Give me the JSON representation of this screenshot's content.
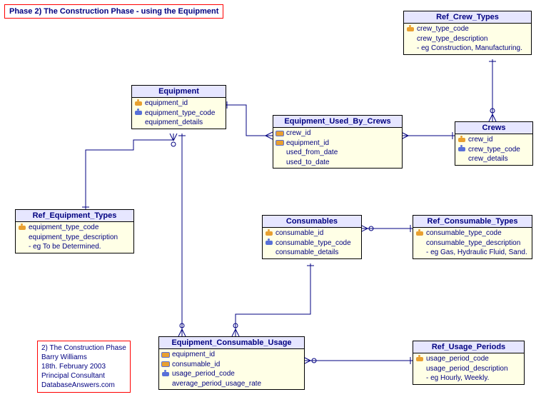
{
  "title": "Phase 2) The Construction Phase - using the Equipment",
  "info": {
    "l1": "2) The Construction Phase",
    "l2": "Barry Williams",
    "l3": "18th. February 2003",
    "l4": "Principal Consultant",
    "l5": "DatabaseAnswers.com"
  },
  "entities": {
    "equipment": {
      "name": "Equipment",
      "c1": "equipment_id",
      "c2": "equipment_type_code",
      "c3": "equipment_details"
    },
    "ref_crew_types": {
      "name": "Ref_Crew_Types",
      "c1": "crew_type_code",
      "c2": "crew_type_description",
      "eg": "- eg Construction, Manufacturing."
    },
    "eubc": {
      "name": "Equipment_Used_By_Crews",
      "c1": "crew_id",
      "c2": "equipment_id",
      "c3": "used_from_date",
      "c4": "used_to_date"
    },
    "crews": {
      "name": "Crews",
      "c1": "crew_id",
      "c2": "crew_type_code",
      "c3": "crew_details"
    },
    "ref_equipment_types": {
      "name": "Ref_Equipment_Types",
      "c1": "equipment_type_code",
      "c2": "equipment_type_description",
      "eg": "- eg To be Determined."
    },
    "consumables": {
      "name": "Consumables",
      "c1": "consumable_id",
      "c2": "consumable_type_code",
      "c3": "consumable_details"
    },
    "ref_consumable_types": {
      "name": "Ref_Consumable_Types",
      "c1": "consumable_type_code",
      "c2": "consumable_type_description",
      "eg": "- eg Gas, Hydraulic Fluid, Sand."
    },
    "ecu": {
      "name": "Equipment_Consumable_Usage",
      "c1": "equipment_id",
      "c2": "consumable_id",
      "c3": "usage_period_code",
      "c4": "average_period_usage_rate"
    },
    "ref_usage_periods": {
      "name": "Ref_Usage_Periods",
      "c1": "usage_period_code",
      "c2": "usage_period_description",
      "eg": "- eg Hourly, Weekly."
    }
  }
}
